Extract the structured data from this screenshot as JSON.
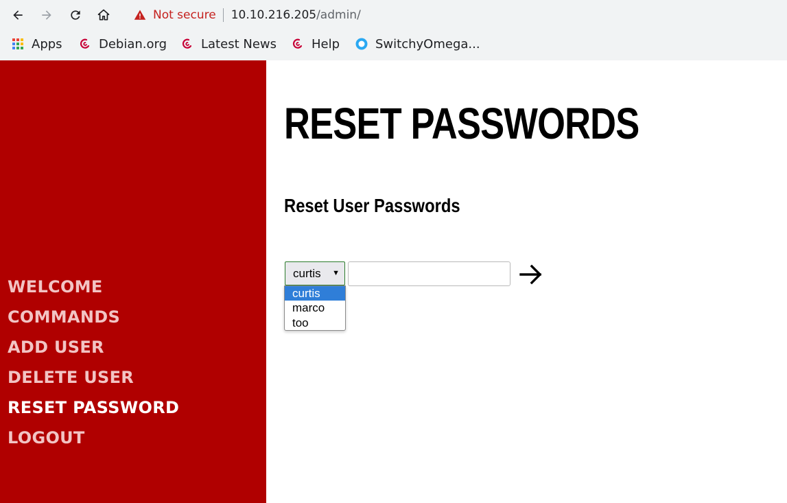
{
  "browser": {
    "security_label": "Not secure",
    "url_host": "10.10.216.205",
    "url_path": "/admin/",
    "bookmarks": [
      {
        "label": "Apps",
        "icon": "apps-grid-icon"
      },
      {
        "label": "Debian.org",
        "icon": "debian-swirl-icon"
      },
      {
        "label": "Latest News",
        "icon": "debian-swirl-icon"
      },
      {
        "label": "Help",
        "icon": "debian-swirl-icon"
      },
      {
        "label": "SwitchyOmega...",
        "icon": "switchyomega-icon"
      }
    ]
  },
  "sidebar": {
    "items": [
      {
        "label": "WELCOME",
        "active": false
      },
      {
        "label": "COMMANDS",
        "active": false
      },
      {
        "label": "ADD USER",
        "active": false
      },
      {
        "label": "DELETE USER",
        "active": false
      },
      {
        "label": "RESET PASSWORD",
        "active": true
      },
      {
        "label": "LOGOUT",
        "active": false
      }
    ]
  },
  "main": {
    "title": "RESET PASSWORDS",
    "subtitle": "Reset User Passwords",
    "user_select": {
      "selected": "curtis",
      "options": [
        "curtis",
        "marco",
        "too"
      ]
    },
    "password_input": {
      "value": "",
      "placeholder": ""
    },
    "submit_icon": "arrow-right-icon"
  },
  "colors": {
    "sidebar_bg": "#b00000",
    "sidebar_link": "#f2c4c4",
    "sidebar_link_active": "#ffffff",
    "warning": "#c5221f",
    "option_highlight": "#2f7ed8"
  }
}
